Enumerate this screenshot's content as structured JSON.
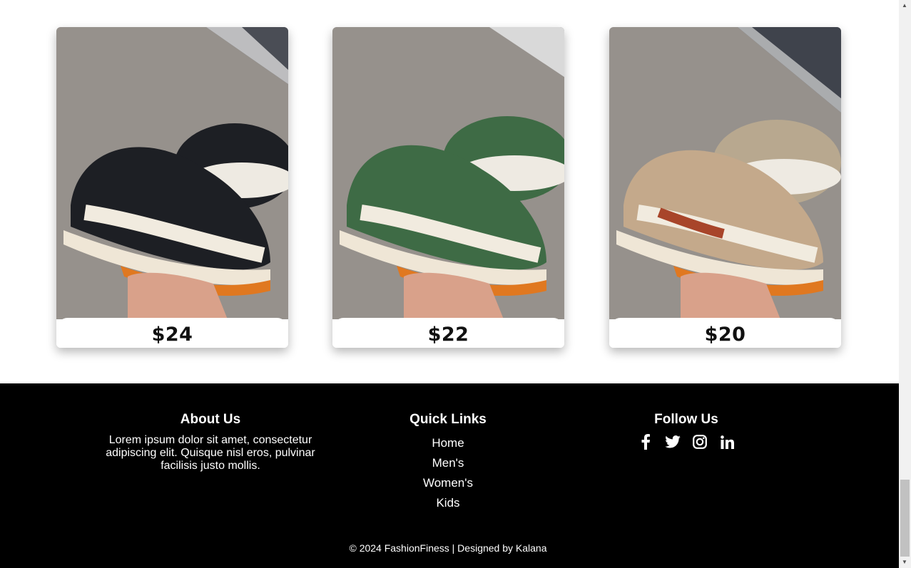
{
  "products": [
    {
      "price": "$24",
      "colorway": "black",
      "color": "#1d1f24"
    },
    {
      "price": "$22",
      "colorway": "green",
      "color": "#3e6b45"
    },
    {
      "price": "$20",
      "colorway": "beige",
      "color": "#c4a98b"
    }
  ],
  "footer": {
    "about": {
      "title": "About Us",
      "text": "Lorem ipsum dolor sit amet, consectetur adipiscing elit. Quisque nisl eros, pulvinar facilisis justo mollis."
    },
    "quick_links": {
      "title": "Quick Links",
      "items": [
        "Home",
        "Men's",
        "Women's",
        "Kids"
      ]
    },
    "follow": {
      "title": "Follow Us",
      "icons": [
        "facebook-icon",
        "twitter-icon",
        "instagram-icon",
        "linkedin-icon"
      ]
    },
    "copyright": "© 2024 FashionFiness | Designed by Kalana"
  },
  "colors": {
    "footer_bg": "#000000",
    "footer_text": "#ffffff"
  }
}
